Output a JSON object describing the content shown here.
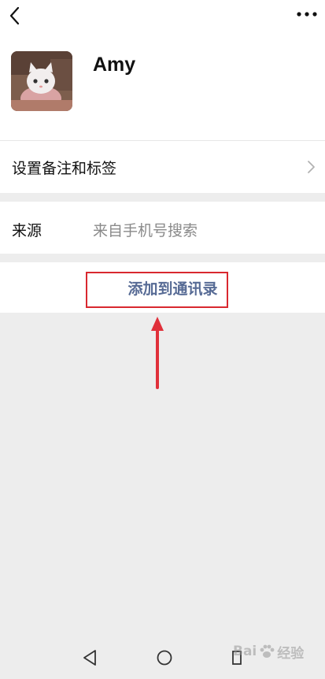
{
  "profile": {
    "name": "Amy"
  },
  "rows": {
    "remark_label": "设置备注和标签",
    "source_label": "来源",
    "source_value": "来自手机号搜索"
  },
  "actions": {
    "add_contact_label": "添加到通讯录"
  },
  "watermark": {
    "text_left": "Bai",
    "text_right": "经验"
  },
  "colors": {
    "link": "#576b95",
    "highlight_box": "#d9282f",
    "arrow": "#e0303a",
    "background": "#ededed"
  }
}
